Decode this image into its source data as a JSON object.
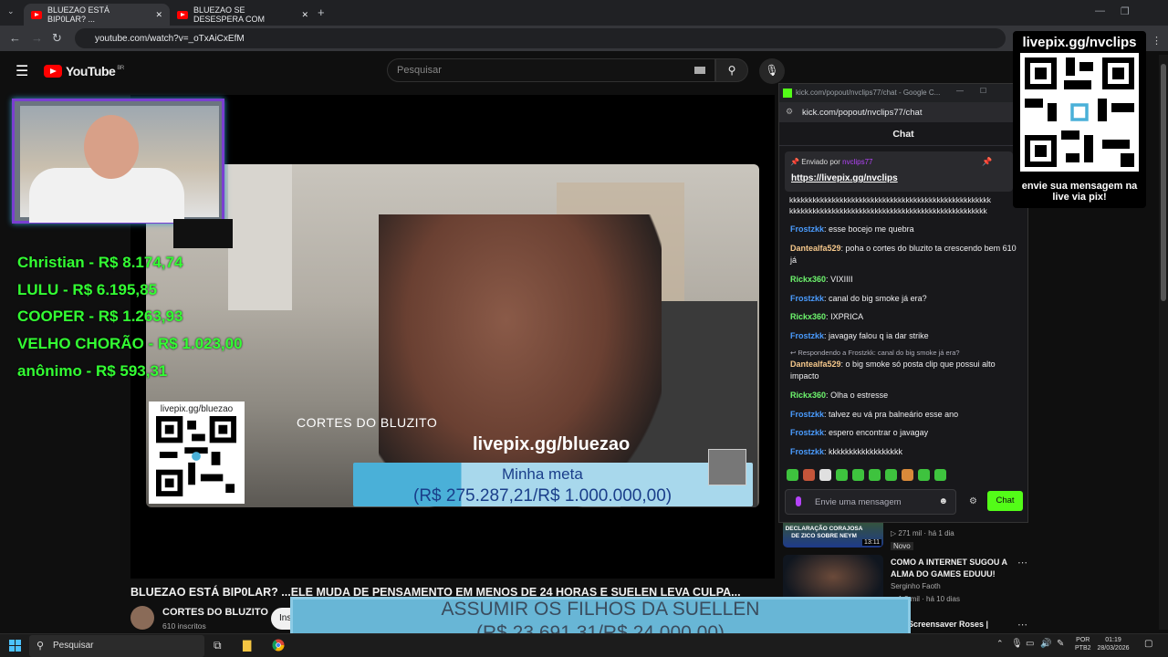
{
  "browser": {
    "tabs": [
      {
        "title": "BLUEZAO ESTÁ BIP0LAR? ...",
        "active": true
      },
      {
        "title": "BLUEZAO SE DESESPERA COM",
        "active": false
      }
    ],
    "url": "youtube.com/watch?v=_oTxAiCxEfM"
  },
  "youtube": {
    "logo": "YouTube",
    "region": "BR",
    "search_placeholder": "Pesquisar"
  },
  "video": {
    "watermark": "CORTES DO BLUZITO",
    "livepix_label": "livepix.gg/bluezao",
    "meta_title": "Minha meta",
    "meta_value": "(R$ 275.287,21/R$ 1.000.000,00)",
    "qr_label": "livepix.gg/bluezao",
    "title": "BLUEZAO ESTÁ BIP0LAR? ...ELE MUDA DE PENSAMENTO EM MENOS DE 24 HORAS E SUELEN LEVA CULPA...",
    "channel_name": "CORTES DO BLUZITO",
    "channel_subs": "610 inscritos",
    "subscribe_label": "Ins"
  },
  "donors": [
    {
      "text": "Christian - R$ 8.174,74"
    },
    {
      "text": "LULU - R$ 6.195,85"
    },
    {
      "text": "COOPER - R$ 1.263,93"
    },
    {
      "text": "VELHO CHORÃO - R$ 1.023,00"
    },
    {
      "text": "anônimo - R$ 593,31"
    }
  ],
  "goal_banner": {
    "title": "ASSUMIR OS FILHOS DA SUELLEN",
    "value": "(R$ 23.691,31/R$ 24.000,00)"
  },
  "chat": {
    "window_title": "kick.com/popout/nvclips77/chat - Google C...",
    "url": "kick.com/popout/nvclips77/chat",
    "header": "Chat",
    "pinned_by_label": "Enviado por",
    "pinned_by_user": "nvclips77",
    "pinned_link": "https://livepix.gg/nvclips",
    "spam_line_1": "kkkkkkkkkkkkkkkkkkkkkkkkkkkkkkkkkkkkkkkkkkkkkkkkkkkk",
    "spam_line_2": "kkkkkkkkkkkkkkkkkkkkkkkkkkkkkkkkkkkkkkkkkkkkkkkkkkk",
    "messages": [
      {
        "user": "Frostzkk",
        "text": "esse bocejo me quebra"
      },
      {
        "user": "Dantealfa529",
        "text": "poha o cortes do bluzito ta crescendo bem 610 já"
      },
      {
        "user": "Rickx360",
        "text": "VIXIIII"
      },
      {
        "user": "Frostzkk",
        "text": "canal do big smoke já era?"
      },
      {
        "user": "Rickx360",
        "text": "IXPRICA"
      },
      {
        "user": "Frostzkk",
        "text": "javagay falou q ia dar strike"
      },
      {
        "user": "Dantealfa529",
        "text": "o big smoke só posta clip que possui alto impacto"
      },
      {
        "user": "Rickx360",
        "text": "Olha o estresse"
      },
      {
        "user": "Frostzkk",
        "text": "talvez eu vá pra balneário esse ano"
      },
      {
        "user": "Frostzkk",
        "text": "espero encontrar o javagay"
      },
      {
        "user": "Frostzkk",
        "text": "kkkkkkkkkkkkkkkkkk"
      }
    ],
    "reply_to": "Respondendo a Frostzkk: canal do big smoke já era?",
    "input_placeholder": "Envie uma mensagem",
    "send_label": "Chat"
  },
  "qr_overlay": {
    "title": "livepix.gg/nvclips",
    "caption_1": "envie sua mensagem na",
    "caption_2": "live via pix!"
  },
  "recommendations": [
    {
      "thumb_text": "DECLARAÇÃO CORAJOSA DE ZICO SOBRE NEYM",
      "duration": "13:11",
      "meta": "▷ 271 mil · há 1 dia",
      "badge": "Novo"
    },
    {
      "title_1": "COMO A INTERNET SUGOU A",
      "title_2": "ALMA DO GAMES EDUUU!",
      "channel": "Serginho Faoth",
      "meta": "▷ 1,3 mil · há 10 dias"
    },
    {
      "title_1": "rt Screensaver Roses |"
    }
  ],
  "taskbar": {
    "search": "Pesquisar",
    "lang_1": "POR",
    "lang_2": "PTB2",
    "time": "01:19",
    "date": "28/03/2026"
  },
  "colors": {
    "kick_green": "#53fc18",
    "donor_green": "#33ff33",
    "youtube_red": "#ff0000"
  }
}
